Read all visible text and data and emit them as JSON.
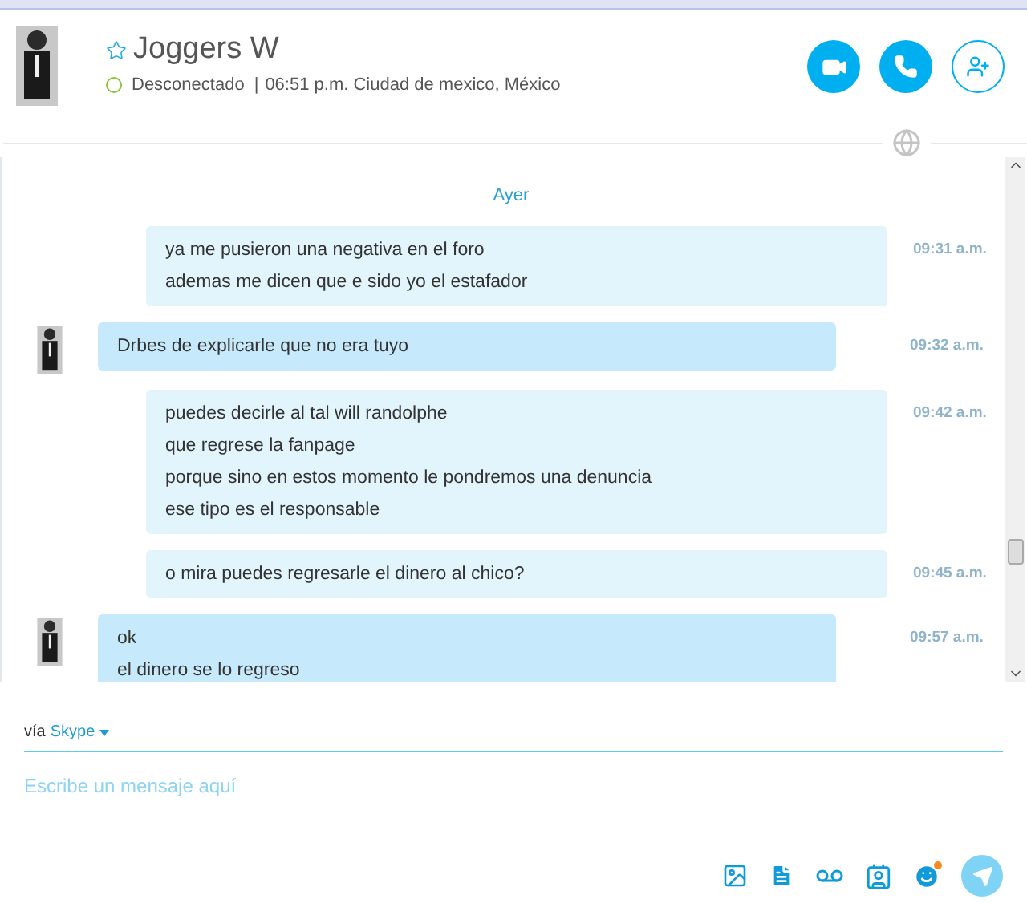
{
  "contact": {
    "name": "Joggers W",
    "favorite": false,
    "status_text": "Desconectado",
    "separator": "|",
    "local_info": "06:51 p.m. Ciudad de mexico, México"
  },
  "day_label": "Ayer",
  "messages": [
    {
      "kind": "sent",
      "lines": [
        "ya me pusieron una negativa en el foro",
        "ademas me dicen que e sido yo el estafador"
      ],
      "time": "09:31 a.m."
    },
    {
      "kind": "received",
      "lines": [
        "Drbes de explicarle que no era tuyo"
      ],
      "time": "09:32 a.m."
    },
    {
      "kind": "sent",
      "lines": [
        "puedes decirle al tal will randolphe",
        "que regrese la fanpage",
        "porque sino en estos momento le pondremos una denuncia",
        "ese tipo es el responsable"
      ],
      "time": "09:42 a.m."
    },
    {
      "kind": "sent",
      "lines": [
        "o mira puedes regresarle el dinero al chico?"
      ],
      "time": "09:45 a.m."
    },
    {
      "kind": "received",
      "lines": [
        "ok",
        "el dinero se lo regreso"
      ],
      "time": "09:57 a.m."
    }
  ],
  "composer": {
    "via_label": "vía",
    "service": "Skype",
    "placeholder": "Escribe un mensaje aquí",
    "emoticon_badge": true
  }
}
